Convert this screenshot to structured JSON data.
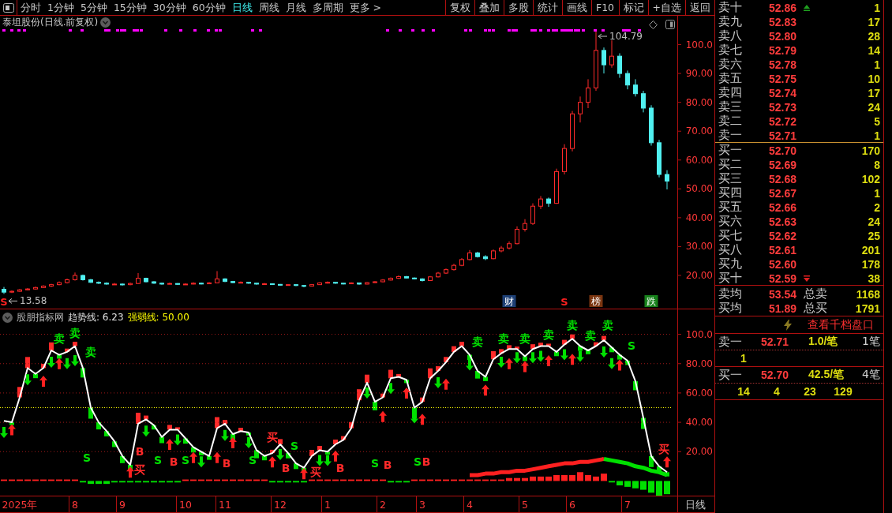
{
  "toolbar": {
    "tabs": [
      {
        "label": "分时",
        "selected": false
      },
      {
        "label": "1分钟",
        "selected": false
      },
      {
        "label": "5分钟",
        "selected": false
      },
      {
        "label": "15分钟",
        "selected": false
      },
      {
        "label": "30分钟",
        "selected": false
      },
      {
        "label": "60分钟",
        "selected": false
      },
      {
        "label": "日线",
        "selected": true
      },
      {
        "label": "周线",
        "selected": false
      },
      {
        "label": "月线",
        "selected": false
      },
      {
        "label": "多周期",
        "selected": false
      },
      {
        "label": "更多 >",
        "selected": false
      }
    ],
    "buttons": [
      "复权",
      "叠加",
      "多股",
      "统计",
      "画线",
      "F10",
      "标记",
      "+自选",
      "返回"
    ]
  },
  "price_chart": {
    "title": "泰坦股份(日线.前复权)",
    "events": [
      {
        "label": "S",
        "kind": "text",
        "color": "#ff2020"
      },
      {
        "label": "财",
        "kind": "tag",
        "color": "#1d3f75"
      },
      {
        "label": "S",
        "kind": "text",
        "color": "#ff2020"
      },
      {
        "label": "榜",
        "kind": "tag",
        "color": "#7a3510"
      },
      {
        "label": "跌",
        "kind": "tag",
        "color": "#16801a"
      }
    ],
    "chart_data": [
      {
        "type": "candlestick",
        "tick_labels": "y",
        "ylim": [
          8.5,
          110
        ],
        "yticks": [
          {
            "value": 100,
            "label": "100.0"
          },
          {
            "value": 90,
            "label": "90.00"
          },
          {
            "value": 80,
            "label": "80.00"
          },
          {
            "value": 70,
            "label": "70.00"
          },
          {
            "value": 60,
            "label": "60.00"
          },
          {
            "value": 50,
            "label": "50.00"
          },
          {
            "value": 40,
            "label": "40.00"
          },
          {
            "value": 30,
            "label": "30.00"
          },
          {
            "value": 20,
            "label": "20.00"
          }
        ],
        "ohlc": [
          [
            15.2,
            16.0,
            13.58,
            14.2
          ],
          [
            14.2,
            14.8,
            13.9,
            14.5
          ],
          [
            14.5,
            15.3,
            14.3,
            15.0
          ],
          [
            15.0,
            15.6,
            14.8,
            15.3
          ],
          [
            15.3,
            16.1,
            15.1,
            15.8
          ],
          [
            15.8,
            16.6,
            15.6,
            16.3
          ],
          [
            16.3,
            17.1,
            16.0,
            16.8
          ],
          [
            16.8,
            17.9,
            16.6,
            17.5
          ],
          [
            17.5,
            18.9,
            17.2,
            18.5
          ],
          [
            18.5,
            21.0,
            18.2,
            20.0
          ],
          [
            20.0,
            20.3,
            18.2,
            18.5
          ],
          [
            18.5,
            18.8,
            17.4,
            17.6
          ],
          [
            17.6,
            17.9,
            17.0,
            17.3
          ],
          [
            17.3,
            17.6,
            16.8,
            17.0
          ],
          [
            16.9,
            17.4,
            16.7,
            17.0
          ],
          [
            17.0,
            17.2,
            16.5,
            16.8
          ],
          [
            16.8,
            17.5,
            16.6,
            17.2
          ],
          [
            17.2,
            20.8,
            17.0,
            19.0
          ],
          [
            19.0,
            19.2,
            17.6,
            17.8
          ],
          [
            17.8,
            18.0,
            17.1,
            17.3
          ],
          [
            17.3,
            17.5,
            16.8,
            17.0
          ],
          [
            17.0,
            17.5,
            16.9,
            17.2
          ],
          [
            17.2,
            17.3,
            16.7,
            16.9
          ],
          [
            16.9,
            17.3,
            16.8,
            17.0
          ],
          [
            17.0,
            17.6,
            16.9,
            17.3
          ],
          [
            17.3,
            17.5,
            16.9,
            17.1
          ],
          [
            17.1,
            17.7,
            17.0,
            17.4
          ],
          [
            17.4,
            21.5,
            17.3,
            18.8
          ],
          [
            18.8,
            19.0,
            17.7,
            17.9
          ],
          [
            17.9,
            18.1,
            17.3,
            17.5
          ],
          [
            17.5,
            17.9,
            17.3,
            17.6
          ],
          [
            17.6,
            17.7,
            17.1,
            17.3
          ],
          [
            17.3,
            17.4,
            16.8,
            17.0
          ],
          [
            17.0,
            17.4,
            16.9,
            17.1
          ],
          [
            17.1,
            17.2,
            16.7,
            16.9
          ],
          [
            16.9,
            17.0,
            16.4,
            16.6
          ],
          [
            16.6,
            17.0,
            16.5,
            16.8
          ],
          [
            16.8,
            16.9,
            16.3,
            16.5
          ],
          [
            16.5,
            16.7,
            15.9,
            16.3
          ],
          [
            16.3,
            17.0,
            16.2,
            16.8
          ],
          [
            16.8,
            17.6,
            16.7,
            17.4
          ],
          [
            17.4,
            17.9,
            17.2,
            17.6
          ],
          [
            17.6,
            17.7,
            17.1,
            17.3
          ],
          [
            17.3,
            17.4,
            16.9,
            17.1
          ],
          [
            17.1,
            17.6,
            17.0,
            17.4
          ],
          [
            17.4,
            17.5,
            16.8,
            17.0
          ],
          [
            17.0,
            17.7,
            16.9,
            17.5
          ],
          [
            17.5,
            18.0,
            17.3,
            17.8
          ],
          [
            17.8,
            18.7,
            17.6,
            18.4
          ],
          [
            18.4,
            19.3,
            18.2,
            19.0
          ],
          [
            19.0,
            20.0,
            18.8,
            19.6
          ],
          [
            19.6,
            19.8,
            18.9,
            19.1
          ],
          [
            19.1,
            19.3,
            18.6,
            18.8
          ],
          [
            18.8,
            19.0,
            17.9,
            18.2
          ],
          [
            18.2,
            19.8,
            18.1,
            19.5
          ],
          [
            19.5,
            21.2,
            19.3,
            20.8
          ],
          [
            20.8,
            22.4,
            20.5,
            22.0
          ],
          [
            22.0,
            24.0,
            21.7,
            23.5
          ],
          [
            23.5,
            26.0,
            23.2,
            25.5
          ],
          [
            25.5,
            28.8,
            25.2,
            27.8
          ],
          [
            27.8,
            28.2,
            26.2,
            26.5
          ],
          [
            26.5,
            27.0,
            25.3,
            25.8
          ],
          [
            25.8,
            29.0,
            25.6,
            28.5
          ],
          [
            28.5,
            30.2,
            28.0,
            29.5
          ],
          [
            29.5,
            31.8,
            29.0,
            31.0
          ],
          [
            31.0,
            37.0,
            30.8,
            36.0
          ],
          [
            36.0,
            39.5,
            35.2,
            38.0
          ],
          [
            38.0,
            45.0,
            37.5,
            44.0
          ],
          [
            44.0,
            47.5,
            43.0,
            46.5
          ],
          [
            46.5,
            47.0,
            43.8,
            45.0
          ],
          [
            45.0,
            57.0,
            44.8,
            56.0
          ],
          [
            56.0,
            65.5,
            55.0,
            64.0
          ],
          [
            64.0,
            77.0,
            63.0,
            76.0
          ],
          [
            76.0,
            82.0,
            73.0,
            80.0
          ],
          [
            80.0,
            88.0,
            78.0,
            85.0
          ],
          [
            85.0,
            104.79,
            84.0,
            98.0
          ],
          [
            98.0,
            99.0,
            90.0,
            93.0
          ],
          [
            93.0,
            101.5,
            92.0,
            96.0
          ],
          [
            96.0,
            97.0,
            88.5,
            90.0
          ],
          [
            90.0,
            91.0,
            84.5,
            86.0
          ],
          [
            86.0,
            88.0,
            82.0,
            83.0
          ],
          [
            83.0,
            84.0,
            76.5,
            78.0
          ],
          [
            78.0,
            79.0,
            65.0,
            66.0
          ],
          [
            66.0,
            67.0,
            54.0,
            55.0
          ],
          [
            55.0,
            56.5,
            49.8,
            52.7
          ]
        ],
        "annotations": [
          "104.79",
          "13.58"
        ]
      }
    ]
  },
  "indicator": {
    "name": "股朋指标网",
    "legend": [
      {
        "label": "趋势线: 6.23",
        "color": "#e0e0e0"
      },
      {
        "label": "强弱线: 50.00",
        "color": "#ffff00"
      }
    ],
    "period_label": "日线",
    "chart_data": [
      {
        "type": "line",
        "ylim": [
          -10,
          117
        ],
        "grid": "dotted",
        "yticks": [
          {
            "value": 100,
            "label": "100.0"
          },
          {
            "value": 80,
            "label": "80.00"
          },
          {
            "value": 60,
            "label": "60.00"
          },
          {
            "value": 40,
            "label": "40.00"
          },
          {
            "value": 20,
            "label": "20.00"
          }
        ],
        "ref_lines": [
          {
            "axis": "y",
            "value": 50,
            "color": "#ffff00",
            "line_style": "dotted"
          }
        ],
        "categories": [
          null,
          null,
          "2025年",
          null,
          null,
          null,
          null,
          null,
          null,
          "8",
          null,
          null,
          null,
          null,
          null,
          "9",
          null,
          null,
          null,
          null,
          null,
          null,
          null,
          "10",
          null,
          null,
          null,
          null,
          "11",
          null,
          null,
          null,
          null,
          null,
          null,
          "12",
          null,
          null,
          null,
          null,
          null,
          "1",
          null,
          null,
          null,
          null,
          null,
          null,
          "2",
          null,
          null,
          null,
          null,
          "3",
          null,
          null,
          null,
          null,
          null,
          "4",
          null,
          null,
          null,
          null,
          null,
          null,
          "5",
          null,
          null,
          null,
          null,
          null,
          "6",
          null,
          null,
          null,
          null,
          null,
          null,
          "7",
          null,
          null,
          null,
          null,
          null
        ],
        "series": [
          {
            "color": "#ffffff",
            "values": [
              41,
              40,
              57,
              77,
              73,
              77,
              89,
              86,
              88,
              92,
              77,
              50,
              40,
              34,
              27,
              17,
              11,
              39,
              42,
              38,
              30,
              35,
              35,
              29,
              23,
              20,
              17,
              36,
              39,
              32,
              34,
              33,
              21,
              17,
              19,
              25,
              19,
              12,
              9,
              17,
              21,
              20,
              25,
              28,
              36,
              55,
              67,
              54,
              57,
              70,
              71,
              69,
              50,
              54,
              70,
              75,
              81,
              88,
              92,
              86,
              75,
              71,
              83,
              87,
              90,
              90,
              85,
              90,
              92,
              92,
              88,
              93,
              97,
              92,
              89,
              92,
              96,
              91,
              86,
              82,
              68,
              43,
              17,
              10,
              6
            ]
          },
          {
            "type": "bar",
            "values": [
              1,
              1,
              1,
              1,
              1,
              1,
              1,
              1,
              1,
              1,
              -1,
              -2,
              -2,
              -2,
              -1,
              -1,
              -1,
              -1,
              -1,
              -1,
              -1,
              -1,
              -1,
              1,
              1,
              1,
              1,
              1,
              1,
              1,
              1,
              1,
              1,
              1,
              -1,
              -1,
              -1,
              -1,
              -1,
              1,
              1,
              1,
              1,
              1,
              1,
              1,
              1,
              1,
              1,
              -1,
              -1,
              -1,
              1,
              1,
              1,
              1,
              1,
              1,
              1,
              1,
              1,
              1,
              1,
              1,
              2,
              2,
              2,
              3,
              3,
              3,
              4,
              4,
              4,
              6,
              4,
              3,
              5,
              -1,
              -3,
              -4,
              -5,
              -6,
              -8,
              -10,
              -9
            ],
            "colors": [
              "#ff2020",
              "#ff2020",
              "#ff2020",
              "#ff2020",
              "#ff2020",
              "#ff2020",
              "#ff2020",
              "#ff2020",
              "#ff2020",
              "#ff2020",
              "#00e000",
              "#00e000",
              "#00e000",
              "#00e000",
              "#00e000",
              "#00e000",
              "#00e000",
              "#00e000",
              "#00e000",
              "#00e000",
              "#00e000",
              "#00e000",
              "#00e000",
              "#ff2020",
              "#ff2020",
              "#ff2020",
              "#ff2020",
              "#ff2020",
              "#ff2020",
              "#ff2020",
              "#ff2020",
              "#ff2020",
              "#ff2020",
              "#ff2020",
              "#00e000",
              "#00e000",
              "#00e000",
              "#00e000",
              "#00e000",
              "#ff2020",
              "#ff2020",
              "#ff2020",
              "#ff2020",
              "#ff2020",
              "#ff2020",
              "#ff2020",
              "#ff2020",
              "#ff2020",
              "#ff2020",
              "#00e000",
              "#00e000",
              "#00e000",
              "#ff2020",
              "#ff2020",
              "#ff2020",
              "#ff2020",
              "#ff2020",
              "#ff2020",
              "#ff2020",
              "#ff2020",
              "#ff2020",
              "#ff2020",
              "#ff2020",
              "#ff2020",
              "#ff2020",
              "#ff2020",
              "#ff2020",
              "#ff2020",
              "#ff2020",
              "#ff2020",
              "#ff2020",
              "#ff2020",
              "#ff2020",
              "#ff2020",
              "#ff2020",
              "#ff2020",
              "#ff2020",
              "#00e000",
              "#00e000",
              "#00e000",
              "#00e000",
              "#00e000",
              "#00e000",
              "#00e000",
              "#00e000"
            ]
          },
          {
            "type": "line",
            "color": "#ff2020",
            "values": [
              null,
              null,
              null,
              null,
              null,
              null,
              null,
              null,
              null,
              null,
              null,
              null,
              null,
              null,
              null,
              null,
              null,
              null,
              null,
              null,
              null,
              null,
              null,
              null,
              null,
              null,
              null,
              null,
              null,
              null,
              null,
              null,
              null,
              null,
              null,
              null,
              null,
              null,
              null,
              null,
              null,
              null,
              null,
              null,
              null,
              null,
              null,
              null,
              null,
              null,
              null,
              null,
              null,
              null,
              null,
              null,
              null,
              null,
              null,
              4,
              4,
              5,
              5,
              6,
              6,
              7,
              7,
              8,
              9,
              10,
              11,
              12,
              12,
              13,
              13,
              14,
              15,
              null,
              null,
              null,
              null,
              null,
              null,
              null,
              null
            ]
          },
          {
            "type": "line",
            "color": "#00e000",
            "values": [
              null,
              null,
              null,
              null,
              null,
              null,
              null,
              null,
              null,
              null,
              null,
              null,
              null,
              null,
              null,
              null,
              null,
              null,
              null,
              null,
              null,
              null,
              null,
              null,
              null,
              null,
              null,
              null,
              null,
              null,
              null,
              null,
              null,
              null,
              null,
              null,
              null,
              null,
              null,
              null,
              null,
              null,
              null,
              null,
              null,
              null,
              null,
              null,
              null,
              null,
              null,
              null,
              null,
              null,
              null,
              null,
              null,
              null,
              null,
              null,
              null,
              null,
              null,
              null,
              null,
              null,
              null,
              null,
              null,
              null,
              null,
              null,
              null,
              null,
              null,
              null,
              15,
              14,
              13,
              12,
              10,
              9,
              7,
              6,
              4
            ]
          },
          {
            "type": "scatter",
            "color": "#ff2020",
            "values": [
              null,
              35,
              null,
              null,
              null,
              68,
              null,
              80,
              null,
              null,
              null,
              null,
              null,
              null,
              null,
              null,
              6,
              null,
              null,
              null,
              null,
              25,
              null,
              null,
              16,
              null,
              null,
              16,
              null,
              26,
              null,
              null,
              null,
              null,
              13,
              null,
              null,
              null,
              5,
              null,
              null,
              null,
              17,
              null,
              null,
              null,
              null,
              null,
              44,
              null,
              null,
              60,
              null,
              42,
              null,
              null,
              66,
              null,
              null,
              null,
              null,
              62,
              null,
              null,
              80,
              null,
              78,
              null,
              null,
              82,
              null,
              null,
              83,
              null,
              null,
              null,
              null,
              null,
              79,
              null,
              null,
              null,
              null,
              null,
              13
            ]
          },
          {
            "type": "scatter",
            "color": "#00e000",
            "values": [
              33,
              null,
              null,
              69,
              null,
              null,
              81,
              null,
              80,
              82,
              null,
              null,
              null,
              null,
              null,
              null,
              null,
              null,
              34,
              null,
              null,
              null,
              28,
              null,
              null,
              13,
              null,
              null,
              31,
              null,
              null,
              26,
              null,
              null,
              null,
              18,
              null,
              null,
              null,
              null,
              14,
              14,
              null,
              null,
              null,
              null,
              60,
              null,
              null,
              63,
              null,
              null,
              43,
              null,
              null,
              67,
              null,
              null,
              null,
              79,
              null,
              null,
              null,
              81,
              null,
              84,
              null,
              84,
              85,
              null,
              null,
              86,
              null,
              85,
              null,
              null,
              88,
              80,
              null,
              null,
              null,
              null,
              null,
              null,
              null
            ]
          }
        ],
        "annotations": [
          "卖",
          "卖",
          "卖",
          "S",
          "B",
          "买",
          "S",
          "B",
          "S",
          "B",
          "S",
          "买",
          "B",
          "S",
          "买",
          "B",
          "S",
          "B",
          "S",
          "B",
          "卖",
          "卖",
          "卖",
          "卖",
          "卖",
          "卖",
          "卖",
          "S",
          "买"
        ]
      }
    ]
  },
  "order_book": {
    "asks": [
      {
        "label": "卖十",
        "price": "52.86",
        "volume": "1"
      },
      {
        "label": "卖九",
        "price": "52.83",
        "volume": "17"
      },
      {
        "label": "卖八",
        "price": "52.80",
        "volume": "28"
      },
      {
        "label": "卖七",
        "price": "52.79",
        "volume": "14"
      },
      {
        "label": "卖六",
        "price": "52.78",
        "volume": "1"
      },
      {
        "label": "卖五",
        "price": "52.75",
        "volume": "10"
      },
      {
        "label": "卖四",
        "price": "52.74",
        "volume": "17"
      },
      {
        "label": "卖三",
        "price": "52.73",
        "volume": "24"
      },
      {
        "label": "卖二",
        "price": "52.72",
        "volume": "5"
      },
      {
        "label": "卖一",
        "price": "52.71",
        "volume": "1"
      }
    ],
    "bids": [
      {
        "label": "买一",
        "price": "52.70",
        "volume": "170"
      },
      {
        "label": "买二",
        "price": "52.69",
        "volume": "8"
      },
      {
        "label": "买三",
        "price": "52.68",
        "volume": "102"
      },
      {
        "label": "买四",
        "price": "52.67",
        "volume": "1"
      },
      {
        "label": "买五",
        "price": "52.66",
        "volume": "2"
      },
      {
        "label": "买六",
        "price": "52.63",
        "volume": "24"
      },
      {
        "label": "买七",
        "price": "52.62",
        "volume": "25"
      },
      {
        "label": "买八",
        "price": "52.61",
        "volume": "201"
      },
      {
        "label": "买九",
        "price": "52.60",
        "volume": "178"
      },
      {
        "label": "买十",
        "price": "52.59",
        "volume": "38"
      }
    ],
    "averages": [
      {
        "label": "卖均",
        "price": "53.54",
        "total_label": "总卖",
        "total": "1168"
      },
      {
        "label": "买均",
        "price": "51.89",
        "total_label": "总买",
        "total": "1791"
      }
    ],
    "depth_link": "查看千档盘口",
    "queues": [
      {
        "label": "卖一",
        "price": "52.71",
        "per_order": "1.0/笔",
        "orders_count": "1笔",
        "orders": [
          "1"
        ]
      },
      {
        "label": "买一",
        "price": "52.70",
        "per_order": "42.5/笔",
        "orders_count": "4笔",
        "orders": [
          "14",
          "4",
          "23",
          "129"
        ]
      }
    ]
  }
}
